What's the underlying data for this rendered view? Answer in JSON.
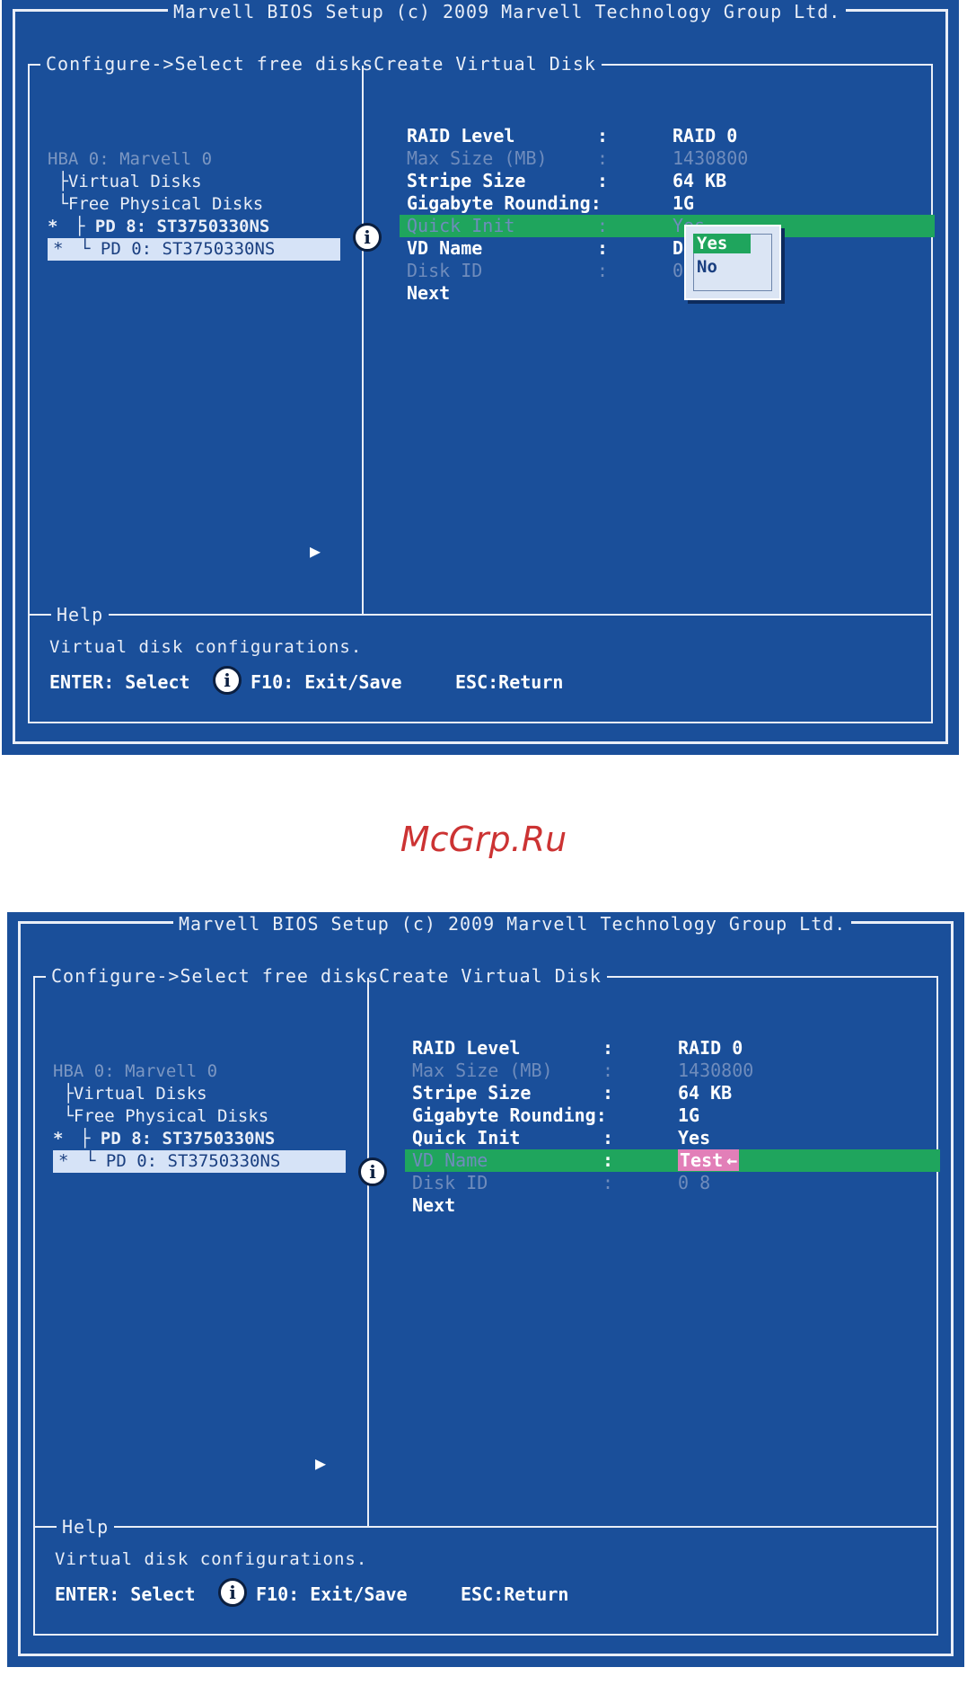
{
  "watermark": "McGrp.Ru",
  "screens": [
    {
      "title": "Marvell BIOS Setup (c) 2009 Marvell Technology Group Ltd.",
      "path": "Configure->Select free disksCreate Virtual Disk",
      "tree": {
        "hba": "HBA 0: Marvell 0",
        "virtual_disks": "Virtual Disks",
        "free_disks": "Free Physical Disks",
        "pd8": "PD 8: ST3750330NS",
        "pd0": "PD 0: ST3750330NS",
        "star": "*"
      },
      "fields": {
        "raid_level": {
          "label": "RAID Level",
          "value": "RAID 0"
        },
        "max_size": {
          "label": "Max Size (MB)",
          "value": "1430800"
        },
        "stripe_size": {
          "label": "Stripe Size",
          "value": "64 KB"
        },
        "gigabyte_rounding": {
          "label": "Gigabyte Rounding:",
          "value": "1G"
        },
        "quick_init": {
          "label": "Quick Init",
          "value": "Yes"
        },
        "vd_name": {
          "label": "VD Name",
          "value": "Def"
        },
        "disk_id": {
          "label": "Disk ID",
          "value": "0 8"
        },
        "next": {
          "label": "Next"
        }
      },
      "colon": ":",
      "popup": {
        "options": [
          "Yes",
          "No"
        ],
        "selected": "Yes"
      },
      "help_label": "Help",
      "help_text": "Virtual disk configurations.",
      "keys": {
        "enter": "ENTER: Select",
        "f10": "F10: Exit/Save",
        "esc": "ESC:Return"
      },
      "highlighted_field": "quick_init"
    },
    {
      "title": "Marvell BIOS Setup (c) 2009 Marvell Technology Group Ltd.",
      "path": "Configure->Select free disksCreate Virtual Disk",
      "tree": {
        "hba": "HBA 0: Marvell 0",
        "virtual_disks": "Virtual Disks",
        "free_disks": "Free Physical Disks",
        "pd8": "PD 8: ST3750330NS",
        "pd0": "PD 0: ST3750330NS",
        "star": "*"
      },
      "fields": {
        "raid_level": {
          "label": "RAID Level",
          "value": "RAID 0"
        },
        "max_size": {
          "label": "Max Size (MB)",
          "value": "1430800"
        },
        "stripe_size": {
          "label": "Stripe Size",
          "value": "64 KB"
        },
        "gigabyte_rounding": {
          "label": "Gigabyte Rounding:",
          "value": "1G"
        },
        "quick_init": {
          "label": "Quick Init",
          "value": "Yes"
        },
        "vd_name": {
          "label": "VD Name",
          "value": "Test"
        },
        "disk_id": {
          "label": "Disk ID",
          "value": "0 8"
        },
        "next": {
          "label": "Next"
        }
      },
      "colon": ":",
      "help_label": "Help",
      "help_text": "Virtual disk configurations.",
      "keys": {
        "enter": "ENTER: Select",
        "f10": "F10: Exit/Save",
        "esc": "ESC:Return"
      },
      "highlighted_field": "vd_name"
    }
  ],
  "colors": {
    "bios_blue": "#1a4f9a",
    "highlight_green": "#1fa55d",
    "edit_pink": "#e27fb8",
    "watermark_red": "#cc3333"
  },
  "icons": [
    "info-icon",
    "arrow-right-icon",
    "enter-icon"
  ]
}
